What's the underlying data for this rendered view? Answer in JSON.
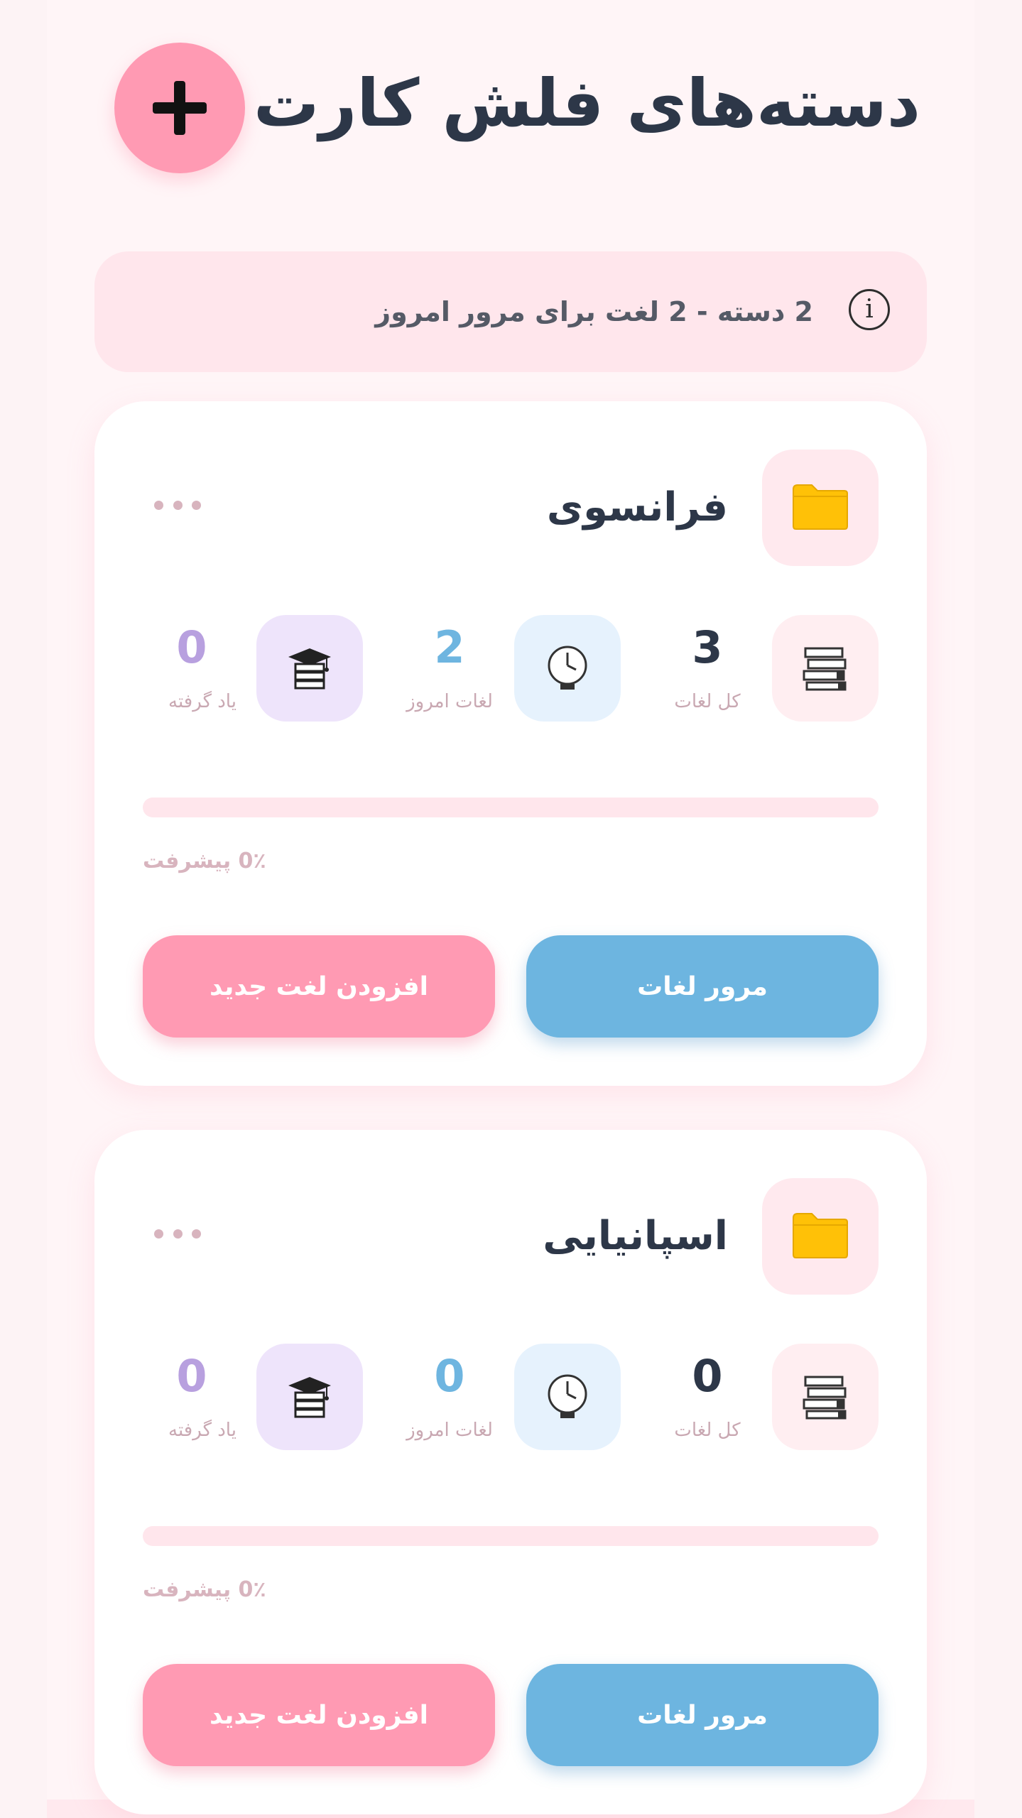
{
  "header": {
    "title": "دسته‌های فلش کارت",
    "add_button_icon": "plus-icon"
  },
  "summary": {
    "icon": "info-icon",
    "text": "2 دسته - 2 لغت برای مرور امروز"
  },
  "decks": [
    {
      "name": "فرانسوی",
      "icon": "folder-icon",
      "stats": {
        "total_value": "3",
        "total_label": "کل لغات",
        "today_value": "2",
        "today_label": "لغات امروز",
        "learned_value": "0",
        "learned_label": "یاد گرفته"
      },
      "progress_percent": 0,
      "progress_text": "0٪ پیشرفت",
      "review_label": "مرور لغات",
      "add_label": "افزودن لغت جدید"
    },
    {
      "name": "اسپانیایی",
      "icon": "folder-icon",
      "stats": {
        "total_value": "0",
        "total_label": "کل لغات",
        "today_value": "0",
        "today_label": "لغات امروز",
        "learned_value": "0",
        "learned_label": "یاد گرفته"
      },
      "progress_percent": 0,
      "progress_text": "0٪ پیشرفت",
      "review_label": "مرور لغات",
      "add_label": "افزودن لغت جدید"
    }
  ],
  "colors": {
    "primary_pink": "#ff9ab3",
    "review_blue": "#6db5e0",
    "learned_purple": "#b8a0df",
    "title_dark": "#2d3748",
    "folder_yellow": "#ffc107"
  }
}
